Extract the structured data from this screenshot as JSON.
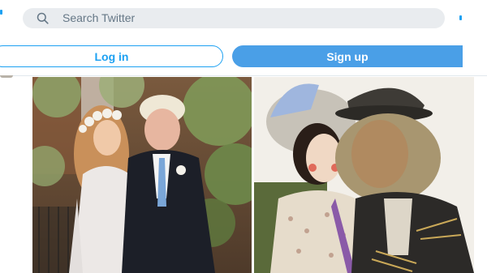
{
  "search": {
    "placeholder": "Search Twitter",
    "icon": "search-icon"
  },
  "auth": {
    "login_label": "Log in",
    "signup_label": "Sign up"
  },
  "tweet": {
    "media": [
      {
        "name": "wedding-photo"
      },
      {
        "name": "worzel-gummidge-photo"
      }
    ]
  },
  "colors": {
    "accent": "#1da1f2",
    "signup_bg": "#4a9fe7",
    "search_bg": "#e9ecef",
    "placeholder": "#657786"
  }
}
